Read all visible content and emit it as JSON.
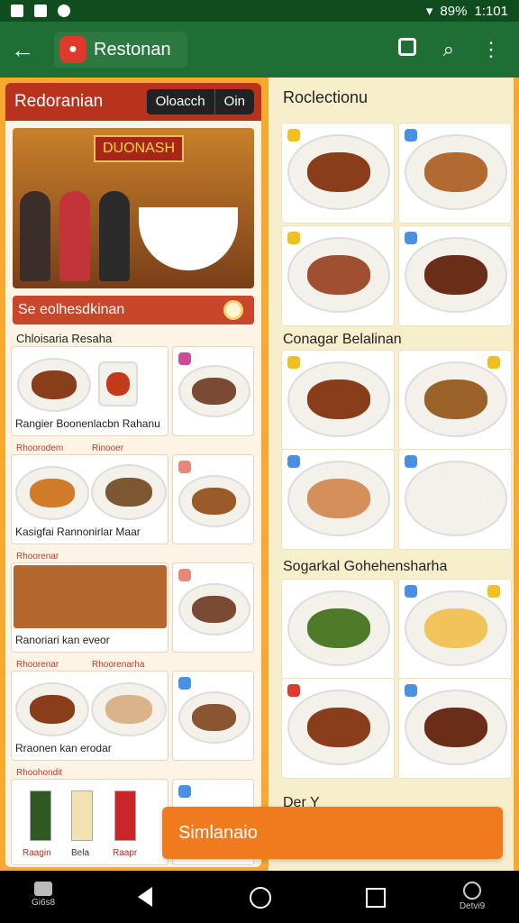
{
  "status_bar": {
    "battery": "89%",
    "time": "1:101"
  },
  "app_bar": {
    "title": "Restonan"
  },
  "left_panel": {
    "header_title": "Redoranian",
    "toggle": [
      "Oloacch",
      "Oin"
    ],
    "hero_sign": "DUONASH",
    "search_label": "Se eolhesdkinan",
    "sections": [
      {
        "heading": "Chloisaria Resaha",
        "card_text": "Rangier Boonenlacbn Rahanu"
      },
      {
        "tag": "Rhoorodem",
        "tag2": "Rinooer",
        "card_text": "Kasigfai Rannonirlar Maar"
      },
      {
        "tag": "Rhoorenar",
        "card_text": "Ranoriari kan eveor"
      },
      {
        "tag": "Rhoorenar",
        "tag2": "Rhoorenarha",
        "card_text": "Rraonen kan erodar"
      },
      {
        "tag": "Rhoohondit",
        "drinks": [
          "Raagin",
          "Bela",
          "Raapr"
        ]
      }
    ]
  },
  "right_panel": {
    "sections": [
      {
        "title": "Roclectionu"
      },
      {
        "title": "Conagar Belalinan"
      },
      {
        "title": "Sogarkal Gohehensharha"
      }
    ],
    "bottom_peek": "Der Y"
  },
  "simulate_button": "Simlanaio",
  "nav_bar": {
    "left_label": "Gi6s8",
    "right_label": "Detvi9"
  }
}
